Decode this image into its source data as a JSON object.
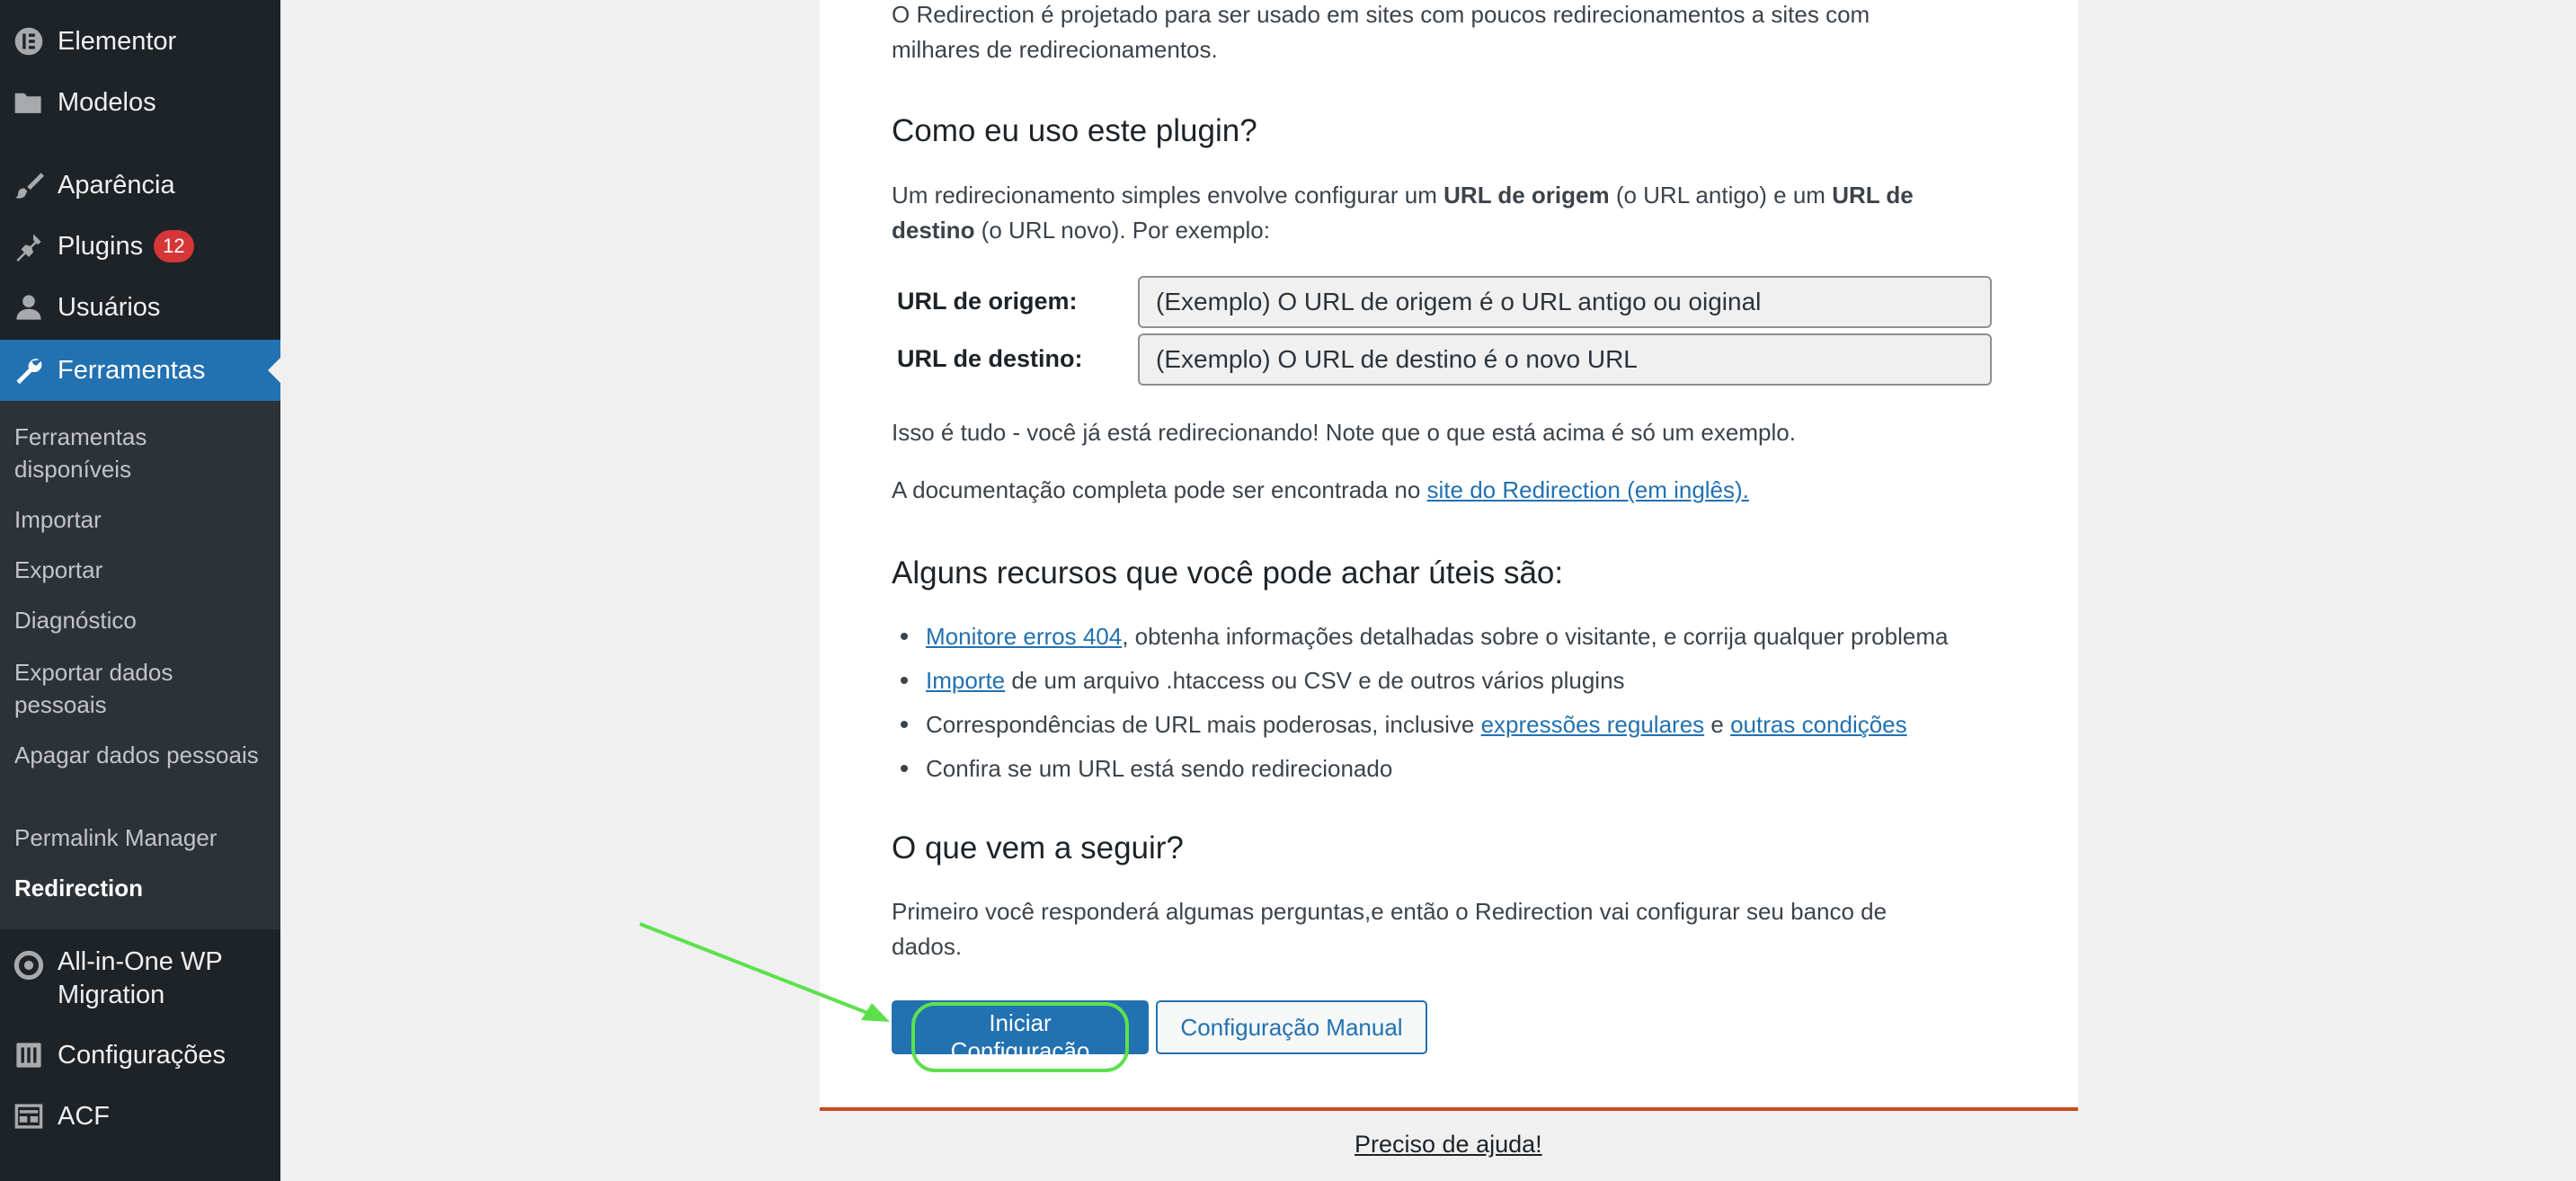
{
  "sidebar": {
    "menu": [
      {
        "label": "Elementor",
        "icon": "elementor-icon"
      },
      {
        "label": "Modelos",
        "icon": "folder-icon"
      },
      {
        "label": "Aparência",
        "icon": "paintbrush-icon"
      },
      {
        "label": "Plugins",
        "icon": "plugin-icon",
        "badge": "12"
      },
      {
        "label": "Usuários",
        "icon": "user-icon"
      },
      {
        "label": "Ferramentas",
        "icon": "wrench-icon"
      },
      {
        "label": "All-in-One WP Migration",
        "icon": "migration-icon"
      },
      {
        "label": "Configurações",
        "icon": "settings-icon"
      },
      {
        "label": "ACF",
        "icon": "acf-icon"
      }
    ],
    "submenu": [
      "Ferramentas disponíveis",
      "Importar",
      "Exportar",
      "Diagnóstico",
      "Exportar dados pessoais",
      "Apagar dados pessoais",
      "Permalink Manager",
      "Redirection"
    ]
  },
  "content": {
    "intro_line1": "O Redirection é projetado para ser usado em sites com poucos redirecionamentos a sites com",
    "intro_line2": "milhares de redirecionamentos.",
    "h_how": "Como eu uso este plugin?",
    "how_p1_a": "Um redirecionamento simples envolve configurar um ",
    "how_p1_b": "URL de origem",
    "how_p1_c": " (o URL antigo) e um ",
    "how_p1_d": "URL de",
    "how_p2_a": "destino",
    "how_p2_b": " (o URL novo). Por exemplo:",
    "source_label": "URL de origem:",
    "source_value": "(Exemplo) O URL de origem é o URL antigo ou oiginal",
    "target_label": "URL de destino:",
    "target_value": "(Exemplo) O URL de destino é o novo URL",
    "thats_all": "Isso é tudo - você já está redirecionando! Note que o que está acima é só um exemplo.",
    "docs_text": "A documentação completa pode ser encontrada no ",
    "docs_link": "site do Redirection (em inglês).",
    "h_features": "Alguns recursos que você pode achar úteis são:",
    "f1_link": "Monitore erros 404",
    "f1_text": ", obtenha informações detalhadas sobre o visitante, e corrija qualquer problema",
    "f2_link": "Importe",
    "f2_text": " de um arquivo .htaccess ou CSV e de outros vários plugins",
    "f3_text": "Correspondências de URL mais poderosas, inclusive ",
    "f3_link1": "expressões regulares",
    "f3_and": " e ",
    "f3_link2": "outras condições",
    "f4_text": "Confira se um URL está sendo redirecionado",
    "h_next": "O que vem a seguir?",
    "next_line1": "Primeiro você responderá algumas perguntas,e então o Redirection vai configurar seu banco de",
    "next_line2": "dados.",
    "btn_start": "Iniciar Configuração",
    "btn_manual": "Configuração Manual"
  },
  "footer": {
    "help_link": "Preciso de ajuda!"
  },
  "colors": {
    "sidebar_bg": "#1d2327",
    "submenu_bg": "#2c3338",
    "accent": "#2271b1",
    "badge": "#d63638",
    "card_border": "#ca4a1f",
    "highlight": "#5ee04d"
  }
}
